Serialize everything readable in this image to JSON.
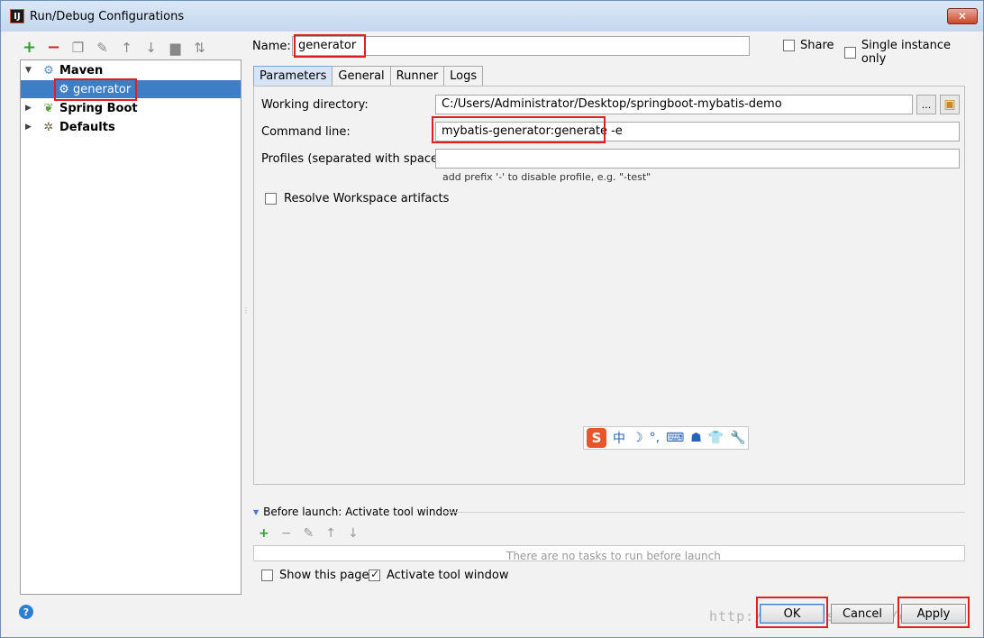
{
  "window": {
    "title": "Run/Debug Configurations",
    "close": "✕"
  },
  "toolbar": {
    "add": "+",
    "remove": "−"
  },
  "tree": {
    "maven": "Maven",
    "generator": "generator",
    "spring_boot": "Spring Boot",
    "defaults": "Defaults"
  },
  "name": {
    "label": "Name:",
    "value": "generator"
  },
  "share": {
    "label": "Share",
    "checked": false
  },
  "single_instance": {
    "label": "Single instance only",
    "checked": false
  },
  "tabs": [
    "Parameters",
    "General",
    "Runner",
    "Logs"
  ],
  "parameters": {
    "working_directory_label": "Working directory:",
    "working_directory_value": "C:/Users/Administrator/Desktop/springboot-mybatis-demo",
    "browse": "...",
    "command_line_label": "Command line:",
    "command_line_value": "mybatis-generator:generate -e",
    "profiles_label": "Profiles (separated with space):",
    "profiles_value": "",
    "profiles_hint": "add prefix '-' to disable profile, e.g. \"-test\"",
    "resolve_label": "Resolve Workspace artifacts"
  },
  "ime": {
    "logo": "S",
    "items": [
      "中",
      "☽",
      "°,",
      "⌨",
      "☗",
      "👕",
      "🔧"
    ]
  },
  "before_launch": {
    "label": "Before launch: Activate tool window",
    "empty_text": "There are no tasks to run before launch"
  },
  "show_page": {
    "label": "Show this page",
    "checked": false
  },
  "activate_tool": {
    "label": "Activate tool window",
    "checked": true
  },
  "buttons": {
    "help": "?",
    "ok": "OK",
    "cancel": "Cancel",
    "apply": "Apply"
  },
  "watermark": "http://blog.csdn.net/gentlu"
}
